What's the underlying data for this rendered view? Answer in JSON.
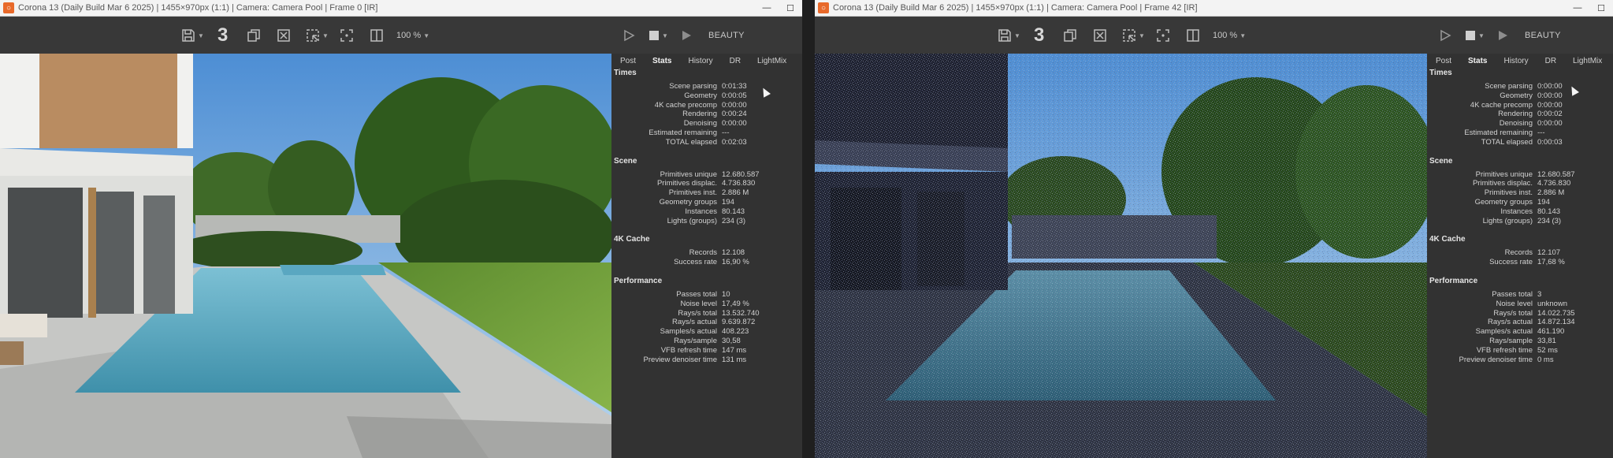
{
  "left": {
    "title": "Corona 13 (Daily Build Mar  6 2025) | 1455×970px (1:1) | Camera: Camera Pool | Frame 0 [IR]",
    "toolbar": {
      "pass_count": "3",
      "zoom": "100 %",
      "channel": "BEAUTY"
    },
    "tabs": [
      "Post",
      "Stats",
      "History",
      "DR",
      "LightMix",
      "Co"
    ],
    "sections": [
      {
        "title": "Times",
        "rows": [
          [
            "Scene parsing",
            "0:01:33"
          ],
          [
            "Geometry",
            "0:00:05"
          ],
          [
            "4K cache precomp",
            "0:00:00"
          ],
          [
            "Rendering",
            "0:00:24"
          ],
          [
            "Denoising",
            "0:00:00"
          ],
          [
            "Estimated remaining",
            "---"
          ],
          [
            "TOTAL elapsed",
            "0:02:03"
          ]
        ]
      },
      {
        "title": "Scene",
        "rows": [
          [
            "Primitives unique",
            "12.680.587"
          ],
          [
            "Primitives displac.",
            "4.736.830"
          ],
          [
            "Primitives inst.",
            "2.886 M"
          ],
          [
            "Geometry groups",
            "194"
          ],
          [
            "Instances",
            "80.143"
          ],
          [
            "Lights (groups)",
            "234 (3)"
          ]
        ]
      },
      {
        "title": "4K Cache",
        "rows": [
          [
            "Records",
            "12.108"
          ],
          [
            "Success rate",
            "16,90 %"
          ]
        ]
      },
      {
        "title": "Performance",
        "rows": [
          [
            "Passes total",
            "10"
          ],
          [
            "Noise level",
            "17,49 %"
          ],
          [
            "Rays/s total",
            "13.532.740"
          ],
          [
            "Rays/s actual",
            "9.639.872"
          ],
          [
            "Samples/s actual",
            "408.223"
          ],
          [
            "Rays/sample",
            "30,58"
          ],
          [
            "VFB refresh time",
            "147 ms"
          ],
          [
            "Preview denoiser time",
            "131 ms"
          ]
        ]
      }
    ]
  },
  "right": {
    "title": "Corona 13 (Daily Build Mar  6 2025) | 1455×970px (1:1) | Camera: Camera Pool | Frame 42 [IR]",
    "toolbar": {
      "pass_count": "3",
      "zoom": "100 %",
      "channel": "BEAUTY"
    },
    "tabs": [
      "Post",
      "Stats",
      "History",
      "DR",
      "LightMix"
    ],
    "sections": [
      {
        "title": "Times",
        "rows": [
          [
            "Scene parsing",
            "0:00:00"
          ],
          [
            "Geometry",
            "0:00:00"
          ],
          [
            "4K cache precomp",
            "0:00:00"
          ],
          [
            "Rendering",
            "0:00:02"
          ],
          [
            "Denoising",
            "0:00:00"
          ],
          [
            "Estimated remaining",
            "---"
          ],
          [
            "TOTAL elapsed",
            "0:00:03"
          ]
        ]
      },
      {
        "title": "Scene",
        "rows": [
          [
            "Primitives unique",
            "12.680.587"
          ],
          [
            "Primitives displac.",
            "4.736.830"
          ],
          [
            "Primitives inst.",
            "2.886 M"
          ],
          [
            "Geometry groups",
            "194"
          ],
          [
            "Instances",
            "80.143"
          ],
          [
            "Lights (groups)",
            "234 (3)"
          ]
        ]
      },
      {
        "title": "4K Cache",
        "rows": [
          [
            "Records",
            "12.107"
          ],
          [
            "Success rate",
            "17,68 %"
          ]
        ]
      },
      {
        "title": "Performance",
        "rows": [
          [
            "Passes total",
            "3"
          ],
          [
            "Noise level",
            "unknown"
          ],
          [
            "Rays/s total",
            "14.022.735"
          ],
          [
            "Rays/s actual",
            "14.872.134"
          ],
          [
            "Samples/s actual",
            "461.190"
          ],
          [
            "Rays/sample",
            "33,81"
          ],
          [
            "VFB refresh time",
            "52 ms"
          ],
          [
            "Preview denoiser time",
            "0 ms"
          ]
        ]
      }
    ]
  },
  "colors": {
    "app_accent": "#e8692a",
    "panel_bg": "#323232",
    "toolbar_bg": "#383838"
  },
  "icons": [
    "app-logo-icon",
    "save-icon",
    "copy-icon",
    "clear-icon",
    "region-select-icon",
    "focus-region-icon",
    "split-view-icon",
    "play-icon",
    "stop-icon",
    "resume-icon",
    "minimize-icon",
    "maximize-icon"
  ]
}
